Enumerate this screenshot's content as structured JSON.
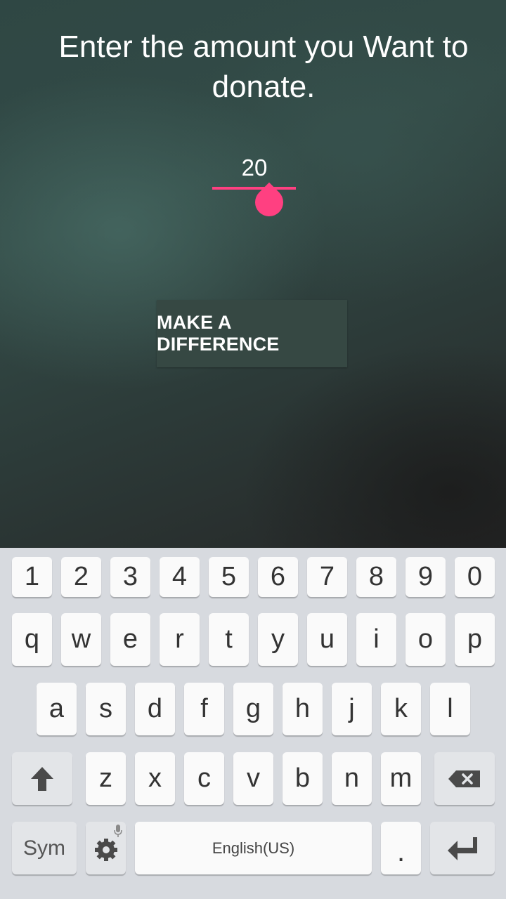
{
  "prompt": {
    "text": "Enter the amount you Want to donate."
  },
  "amount": {
    "value": "20"
  },
  "cta_label": "MAKE A DIFFERENCE",
  "keyboard": {
    "number_row": [
      "1",
      "2",
      "3",
      "4",
      "5",
      "6",
      "7",
      "8",
      "9",
      "0"
    ],
    "row1": [
      "q",
      "w",
      "e",
      "r",
      "t",
      "y",
      "u",
      "i",
      "o",
      "p"
    ],
    "row2": [
      "a",
      "s",
      "d",
      "f",
      "g",
      "h",
      "j",
      "k",
      "l"
    ],
    "row3": [
      "z",
      "x",
      "c",
      "v",
      "b",
      "n",
      "m"
    ],
    "sym_label": "Sym",
    "space_label": "English(US)",
    "period_label": ".",
    "icons": {
      "shift": "shift-arrow-icon",
      "backspace": "backspace-icon",
      "settings": "gear-icon",
      "mic": "mic-icon",
      "enter": "enter-icon"
    }
  },
  "colors": {
    "accent": "#ff4081",
    "button_bg": "#364843",
    "keyboard_bg": "#d7dadf",
    "key_bg": "#fafafa"
  }
}
